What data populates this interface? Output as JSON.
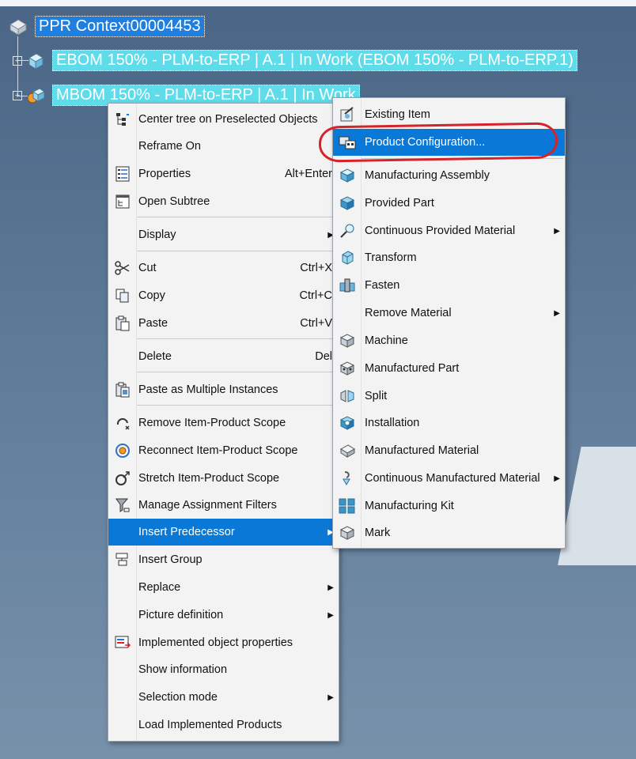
{
  "tree": {
    "root": "PPR Context00004453",
    "ebom": "EBOM 150% - PLM-to-ERP  | A.1  | In Work (EBOM 150% - PLM-to-ERP.1)",
    "mbom": "MBOM 150% - PLM-to-ERP  | A.1  | In Work"
  },
  "context_menu": {
    "items": [
      {
        "label": "Center tree on Preselected Objects",
        "icon": "center-tree-icon"
      },
      {
        "label": "Reframe On"
      },
      {
        "label": "Properties",
        "shortcut": "Alt+Enter",
        "icon": "properties-icon"
      },
      {
        "label": "Open Subtree",
        "icon": "open-subtree-icon"
      },
      {
        "label": "Display",
        "submenu": true
      },
      {
        "label": "Cut",
        "shortcut": "Ctrl+X",
        "icon": "scissors-icon"
      },
      {
        "label": "Copy",
        "shortcut": "Ctrl+C",
        "icon": "copy-icon"
      },
      {
        "label": "Paste",
        "shortcut": "Ctrl+V",
        "icon": "paste-icon"
      },
      {
        "label": "Delete",
        "shortcut": "Del"
      },
      {
        "label": "Paste as Multiple Instances",
        "icon": "paste-multiple-icon"
      },
      {
        "label": "Remove Item-Product Scope",
        "icon": "remove-scope-icon"
      },
      {
        "label": "Reconnect Item-Product Scope",
        "icon": "reconnect-scope-icon"
      },
      {
        "label": "Stretch Item-Product Scope",
        "icon": "stretch-scope-icon"
      },
      {
        "label": "Manage Assignment Filters",
        "icon": "filter-icon"
      },
      {
        "label": "Insert Predecessor",
        "submenu": true,
        "highlighted": true
      },
      {
        "label": "Insert Group",
        "icon": "insert-group-icon"
      },
      {
        "label": "Replace",
        "submenu": true
      },
      {
        "label": "Picture definition",
        "submenu": true
      },
      {
        "label": "Implemented object properties",
        "icon": "implemented-properties-icon"
      },
      {
        "label": "Show information"
      },
      {
        "label": "Selection mode",
        "submenu": true
      },
      {
        "label": "Load Implemented Products"
      }
    ]
  },
  "submenu": {
    "items": [
      {
        "label": "Existing Item",
        "icon": "existing-item-icon"
      },
      {
        "label": "Product Configuration...",
        "icon": "product-configuration-icon",
        "highlighted": true
      },
      {
        "label": "Manufacturing Assembly",
        "icon": "manufacturing-assembly-icon"
      },
      {
        "label": "Provided Part",
        "icon": "provided-part-icon"
      },
      {
        "label": "Continuous Provided Material",
        "icon": "continuous-provided-icon",
        "submenu": true
      },
      {
        "label": "Transform",
        "icon": "transform-icon"
      },
      {
        "label": "Fasten",
        "icon": "fasten-icon"
      },
      {
        "label": "Remove Material",
        "submenu": true
      },
      {
        "label": "Machine",
        "icon": "machine-icon"
      },
      {
        "label": "Manufactured Part",
        "icon": "manufactured-part-icon"
      },
      {
        "label": "Split",
        "icon": "split-icon"
      },
      {
        "label": "Installation",
        "icon": "installation-icon"
      },
      {
        "label": "Manufactured Material",
        "icon": "manufactured-material-icon"
      },
      {
        "label": "Continuous Manufactured Material",
        "icon": "continuous-manufactured-icon",
        "submenu": true
      },
      {
        "label": "Manufacturing Kit",
        "icon": "manufacturing-kit-icon"
      },
      {
        "label": "Mark",
        "icon": "mark-icon"
      }
    ]
  },
  "colors": {
    "highlight": "#0a78d7",
    "annotation": "#d4232b",
    "tree_label": "#5fdcea"
  }
}
